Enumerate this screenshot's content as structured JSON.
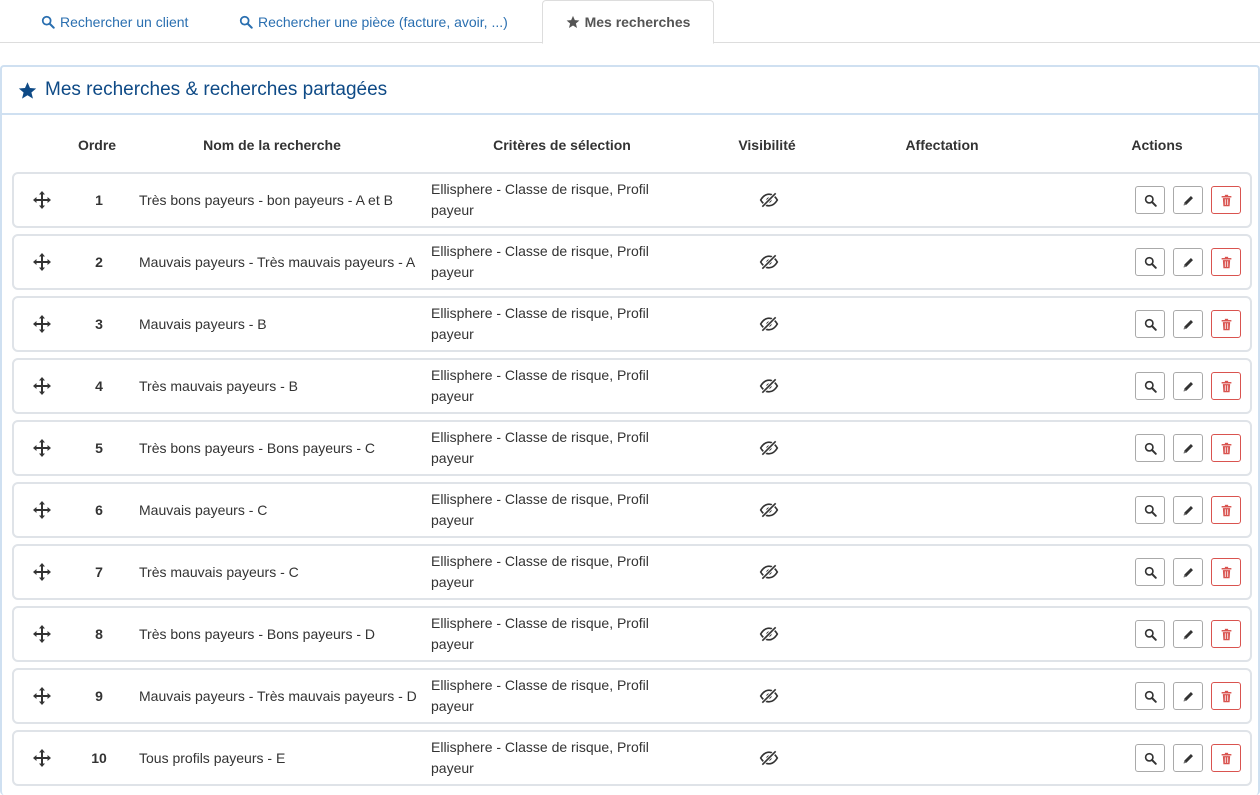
{
  "tabs": [
    {
      "label": "Rechercher un client",
      "icon": "search-icon"
    },
    {
      "label": "Rechercher une pièce (facture, avoir, ...)",
      "icon": "search-icon"
    },
    {
      "label": "Mes recherches",
      "icon": "star-icon",
      "active": true
    }
  ],
  "panel": {
    "title": "Mes recherches & recherches partagées",
    "icon": "star-icon"
  },
  "table": {
    "headers": {
      "order": "Ordre",
      "name": "Nom de la recherche",
      "criteria": "Critères de sélection",
      "visibility": "Visibilité",
      "assignment": "Affectation",
      "actions": "Actions"
    },
    "rows": [
      {
        "order": "1",
        "name": "Très bons payeurs - bon payeurs - A et B",
        "criteria": "Ellisphere - Classe de risque, Profil payeur",
        "visibility_icon": "eye-slash-icon",
        "assignment": ""
      },
      {
        "order": "2",
        "name": "Mauvais payeurs - Très mauvais payeurs - A",
        "criteria": "Ellisphere - Classe de risque, Profil payeur",
        "visibility_icon": "eye-slash-icon",
        "assignment": ""
      },
      {
        "order": "3",
        "name": "Mauvais payeurs - B",
        "criteria": "Ellisphere - Classe de risque, Profil payeur",
        "visibility_icon": "eye-slash-icon",
        "assignment": ""
      },
      {
        "order": "4",
        "name": "Très mauvais payeurs - B",
        "criteria": "Ellisphere - Classe de risque, Profil payeur",
        "visibility_icon": "eye-slash-icon",
        "assignment": ""
      },
      {
        "order": "5",
        "name": "Très bons payeurs - Bons payeurs - C",
        "criteria": "Ellisphere - Classe de risque, Profil payeur",
        "visibility_icon": "eye-slash-icon",
        "assignment": ""
      },
      {
        "order": "6",
        "name": "Mauvais payeurs - C",
        "criteria": "Ellisphere - Classe de risque, Profil payeur",
        "visibility_icon": "eye-slash-icon",
        "assignment": ""
      },
      {
        "order": "7",
        "name": "Très mauvais payeurs - C",
        "criteria": "Ellisphere - Classe de risque, Profil payeur",
        "visibility_icon": "eye-slash-icon",
        "assignment": ""
      },
      {
        "order": "8",
        "name": "Très bons payeurs - Bons payeurs - D",
        "criteria": "Ellisphere - Classe de risque, Profil payeur",
        "visibility_icon": "eye-slash-icon",
        "assignment": ""
      },
      {
        "order": "9",
        "name": "Mauvais payeurs - Très mauvais payeurs - D",
        "criteria": "Ellisphere - Classe de risque, Profil payeur",
        "visibility_icon": "eye-slash-icon",
        "assignment": ""
      },
      {
        "order": "10",
        "name": "Tous profils payeurs - E",
        "criteria": "Ellisphere - Classe de risque, Profil payeur",
        "visibility_icon": "eye-slash-icon",
        "assignment": ""
      }
    ],
    "row_actions": [
      "search-icon",
      "pencil-icon",
      "trash-icon"
    ]
  },
  "colors": {
    "link": "#2a6fb0",
    "panel_title": "#0e4a86",
    "panel_border": "#cfe0f1",
    "delete": "#d9534f"
  }
}
